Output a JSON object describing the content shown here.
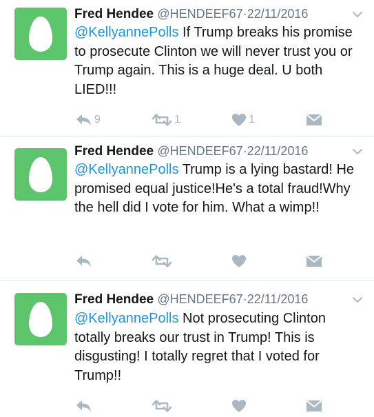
{
  "tweets": [
    {
      "name": "Fred Hendee",
      "handle": "@HENDEEF67",
      "separator": "·",
      "date": "22/11/2016",
      "mention": "@KellyannePolls",
      "text": " If Trump breaks his promise to prosecute Clinton we will never trust you or Trump again. This is a huge deal. U both LIED!!!",
      "replies": "9",
      "retweets": "1",
      "likes": "1"
    },
    {
      "name": "Fred Hendee",
      "handle": "@HENDEEF67",
      "separator": "·",
      "date": "22/11/2016",
      "mention": "@KellyannePolls",
      "text": " Trump is a lying bastard! He promised equal justice!He's a total fraud!Why the hell did I vote for him. What a wimp!!",
      "replies": "",
      "retweets": "",
      "likes": ""
    },
    {
      "name": "Fred Hendee",
      "handle": "@HENDEEF67",
      "separator": "·",
      "date": "22/11/2016",
      "mention": "@KellyannePolls",
      "text": " Not prosecuting Clinton totally breaks our trust in Trump! This is disgusting! I totally regret that I voted for Trump!!",
      "replies": "",
      "retweets": "",
      "likes": ""
    }
  ],
  "colors": {
    "avatar_bg": "#5cc46a",
    "egg": "#ffffff",
    "link": "#1b95e0",
    "icon": "#aab8c2",
    "meta": "#657786"
  },
  "icons": [
    "egg-avatar-icon",
    "caret-down-icon",
    "reply-icon",
    "retweet-icon",
    "like-icon",
    "direct-message-icon"
  ]
}
